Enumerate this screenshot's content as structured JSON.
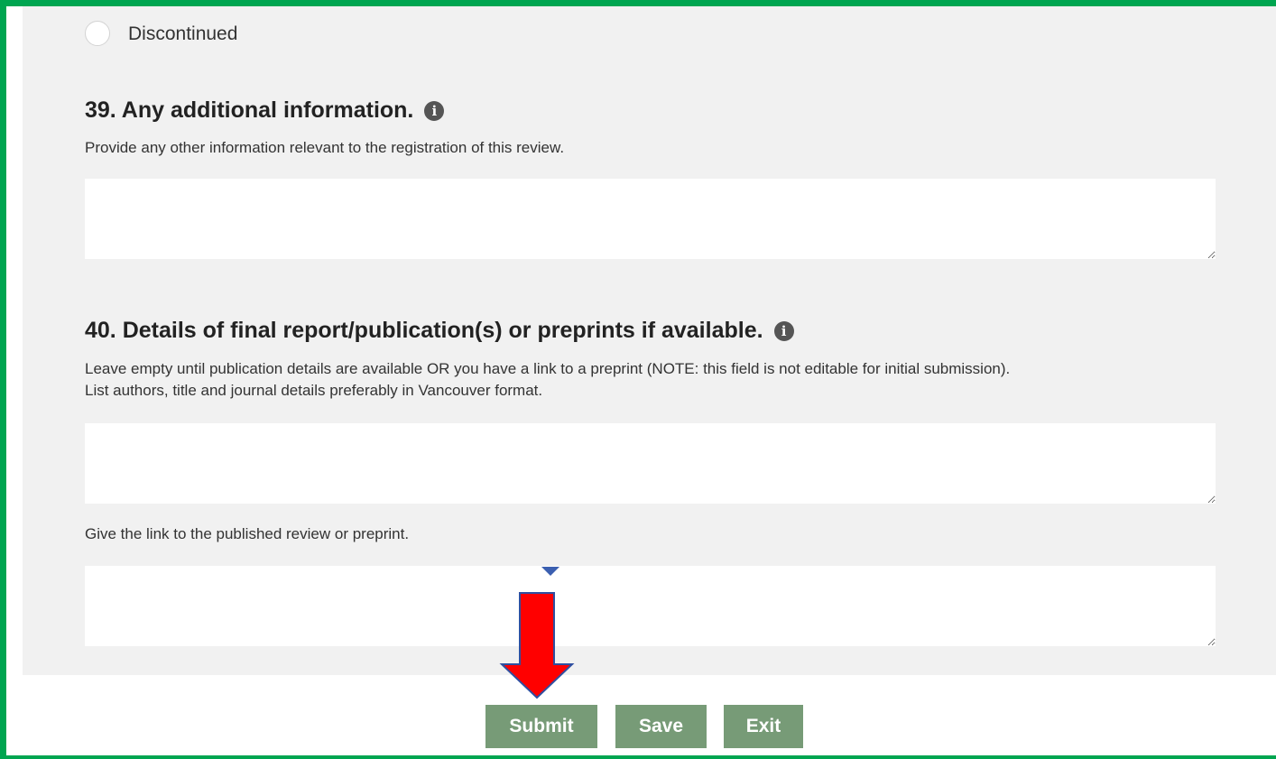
{
  "radio_option": {
    "label": "Discontinued",
    "selected": false
  },
  "q39": {
    "title": "39. Any additional information.",
    "icon": "info-icon",
    "description": "Provide any other information relevant to the registration of this review.",
    "value": ""
  },
  "q40": {
    "title": "40. Details of final report/publication(s) or preprints if available.",
    "icon": "info-icon",
    "description_line1": "Leave empty until publication details are available OR you have a link to a preprint (NOTE: this field is not editable for initial submission).",
    "description_line2": "List authors, title and journal details preferably in Vancouver format.",
    "value": "",
    "link_prompt": "Give the link to the published review or preprint.",
    "link_value": ""
  },
  "buttons": {
    "submit": "Submit",
    "save": "Save",
    "exit": "Exit"
  },
  "colors": {
    "frame_border": "#00a550",
    "button_bg": "#779b77",
    "annotation_arrow": "#ff0000",
    "annotation_outline": "#2f4fa0"
  }
}
